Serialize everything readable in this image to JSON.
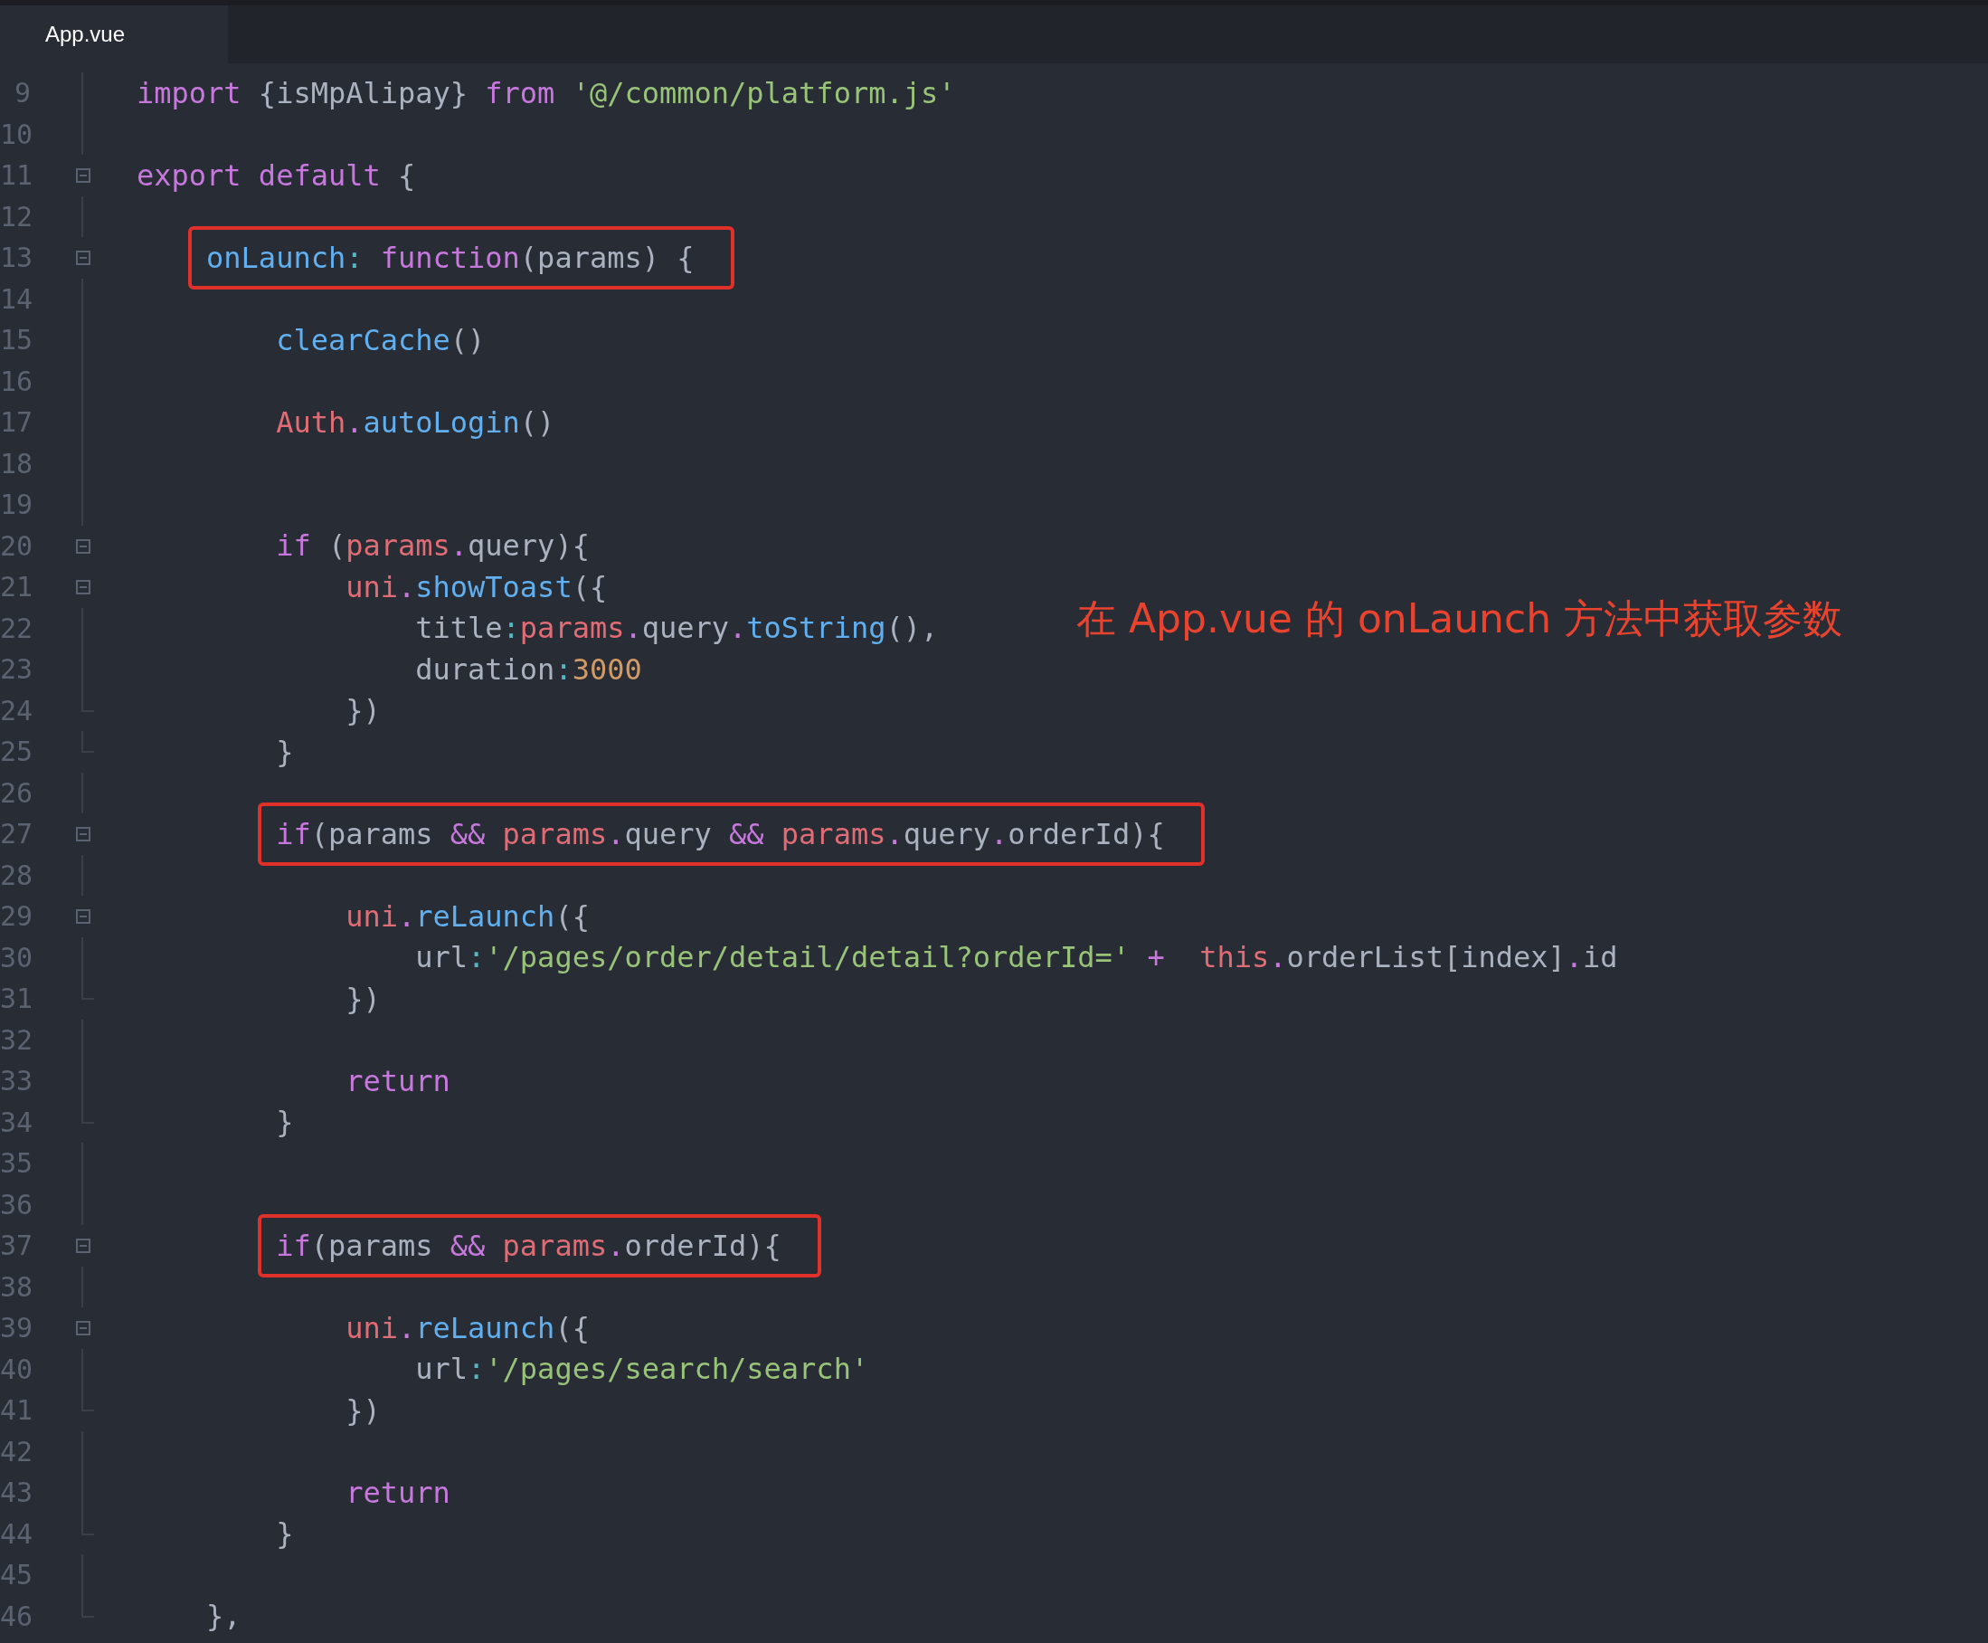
{
  "tab": {
    "label": "App.vue",
    "selected": true
  },
  "lines": [
    {
      "number": "9",
      "fold_start": false,
      "fold_end": false,
      "highlighted": false,
      "tokens": [
        {
          "text": "import",
          "kind": "kw"
        },
        {
          "text": " {isMpAlipay} ",
          "kind": "plain"
        },
        {
          "text": "from",
          "kind": "kw"
        },
        {
          "text": " '@/common/platform.js'",
          "kind": "str"
        }
      ]
    },
    {
      "number": "10",
      "fold_start": false,
      "fold_end": false,
      "highlighted": false
    },
    {
      "number": "11",
      "fold_start": true,
      "fold_end": false,
      "highlighted": false,
      "tokens": [
        {
          "text": "export default",
          "kind": "kw"
        },
        {
          "text": " {",
          "kind": "plain"
        }
      ]
    },
    {
      "number": "12",
      "fold_start": false,
      "fold_end": false,
      "highlighted": false
    },
    {
      "number": "13",
      "fold_start": true,
      "fold_end": false,
      "highlighted": true,
      "tokens": [
        {
          "text": "    onLaunch",
          "kind": "fn"
        },
        {
          "text": ":",
          "kind": "colon"
        },
        {
          "text": " function",
          "kind": "kw"
        },
        {
          "text": "(params) {",
          "kind": "plain"
        }
      ]
    },
    {
      "number": "14",
      "fold_start": false,
      "fold_end": false,
      "highlighted": false
    },
    {
      "number": "15",
      "fold_start": false,
      "fold_end": false,
      "highlighted": false,
      "tokens": [
        {
          "text": "        clearCache",
          "kind": "fn"
        },
        {
          "text": "()",
          "kind": "plain"
        }
      ]
    },
    {
      "number": "16",
      "fold_start": false,
      "fold_end": false,
      "highlighted": false
    },
    {
      "number": "17",
      "fold_start": false,
      "fold_end": false,
      "highlighted": false,
      "tokens": [
        {
          "text": "        Auth",
          "kind": "var"
        },
        {
          "text": ".",
          "kind": "op"
        },
        {
          "text": "autoLogin",
          "kind": "fn"
        },
        {
          "text": "()",
          "kind": "plain"
        }
      ]
    },
    {
      "number": "18",
      "fold_start": false,
      "fold_end": false,
      "highlighted": false
    },
    {
      "number": "19",
      "fold_start": false,
      "fold_end": false,
      "highlighted": false
    },
    {
      "number": "20",
      "fold_start": true,
      "fold_end": false,
      "highlighted": false,
      "tokens": [
        {
          "text": "        if",
          "kind": "kw"
        },
        {
          "text": " (",
          "kind": "plain"
        },
        {
          "text": "params",
          "kind": "var"
        },
        {
          "text": ".",
          "kind": "op"
        },
        {
          "text": "query){",
          "kind": "plain"
        }
      ]
    },
    {
      "number": "21",
      "fold_start": true,
      "fold_end": false,
      "highlighted": false,
      "tokens": [
        {
          "text": "            uni",
          "kind": "var"
        },
        {
          "text": ".",
          "kind": "op"
        },
        {
          "text": "showToast",
          "kind": "fn"
        },
        {
          "text": "({",
          "kind": "plain"
        }
      ]
    },
    {
      "number": "22",
      "fold_start": false,
      "fold_end": false,
      "highlighted": false,
      "tokens": [
        {
          "text": "                title",
          "kind": "plain"
        },
        {
          "text": ":",
          "kind": "colon"
        },
        {
          "text": "params",
          "kind": "var"
        },
        {
          "text": ".",
          "kind": "op"
        },
        {
          "text": "query",
          "kind": "plain"
        },
        {
          "text": ".",
          "kind": "op"
        },
        {
          "text": "toString",
          "kind": "fn"
        },
        {
          "text": "(),",
          "kind": "plain"
        }
      ]
    },
    {
      "number": "23",
      "fold_start": false,
      "fold_end": false,
      "highlighted": false,
      "tokens": [
        {
          "text": "                duration",
          "kind": "plain"
        },
        {
          "text": ":",
          "kind": "colon"
        },
        {
          "text": "3000",
          "kind": "num"
        }
      ]
    },
    {
      "number": "24",
      "fold_start": false,
      "fold_end": true,
      "highlighted": false,
      "tokens": [
        {
          "text": "            })",
          "kind": "plain"
        }
      ]
    },
    {
      "number": "25",
      "fold_start": false,
      "fold_end": true,
      "highlighted": false,
      "tokens": [
        {
          "text": "        }",
          "kind": "plain"
        }
      ]
    },
    {
      "number": "26",
      "fold_start": false,
      "fold_end": false,
      "highlighted": false
    },
    {
      "number": "27",
      "fold_start": true,
      "fold_end": false,
      "highlighted": true,
      "tokens": [
        {
          "text": "        if",
          "kind": "kw"
        },
        {
          "text": "(params ",
          "kind": "plain"
        },
        {
          "text": "&&",
          "kind": "op"
        },
        {
          "text": " params",
          "kind": "var"
        },
        {
          "text": ".",
          "kind": "op"
        },
        {
          "text": "query ",
          "kind": "plain"
        },
        {
          "text": "&&",
          "kind": "op"
        },
        {
          "text": " params",
          "kind": "var"
        },
        {
          "text": ".",
          "kind": "op"
        },
        {
          "text": "query",
          "kind": "plain"
        },
        {
          "text": ".",
          "kind": "op"
        },
        {
          "text": "orderId){",
          "kind": "plain"
        }
      ]
    },
    {
      "number": "28",
      "fold_start": false,
      "fold_end": false,
      "highlighted": false
    },
    {
      "number": "29",
      "fold_start": true,
      "fold_end": false,
      "highlighted": false,
      "tokens": [
        {
          "text": "            uni",
          "kind": "var"
        },
        {
          "text": ".",
          "kind": "op"
        },
        {
          "text": "reLaunch",
          "kind": "fn"
        },
        {
          "text": "({",
          "kind": "plain"
        }
      ]
    },
    {
      "number": "30",
      "fold_start": false,
      "fold_end": false,
      "highlighted": false,
      "tokens": [
        {
          "text": "                url",
          "kind": "plain"
        },
        {
          "text": ":",
          "kind": "colon"
        },
        {
          "text": "'/pages/order/detail/detail?orderId='",
          "kind": "str"
        },
        {
          "text": " +",
          "kind": "op"
        },
        {
          "text": "  this",
          "kind": "var"
        },
        {
          "text": ".",
          "kind": "op"
        },
        {
          "text": "orderList[index]",
          "kind": "plain"
        },
        {
          "text": ".",
          "kind": "op"
        },
        {
          "text": "id",
          "kind": "plain"
        }
      ]
    },
    {
      "number": "31",
      "fold_start": false,
      "fold_end": true,
      "highlighted": false,
      "tokens": [
        {
          "text": "            })",
          "kind": "plain"
        }
      ]
    },
    {
      "number": "32",
      "fold_start": false,
      "fold_end": false,
      "highlighted": false
    },
    {
      "number": "33",
      "fold_start": false,
      "fold_end": false,
      "highlighted": false,
      "tokens": [
        {
          "text": "            return",
          "kind": "kw"
        }
      ]
    },
    {
      "number": "34",
      "fold_start": false,
      "fold_end": true,
      "highlighted": false,
      "tokens": [
        {
          "text": "        }",
          "kind": "plain"
        }
      ]
    },
    {
      "number": "35",
      "fold_start": false,
      "fold_end": false,
      "highlighted": false
    },
    {
      "number": "36",
      "fold_start": false,
      "fold_end": false,
      "highlighted": false
    },
    {
      "number": "37",
      "fold_start": true,
      "fold_end": false,
      "highlighted": true,
      "tokens": [
        {
          "text": "        if",
          "kind": "kw"
        },
        {
          "text": "(params ",
          "kind": "plain"
        },
        {
          "text": "&&",
          "kind": "op"
        },
        {
          "text": " params",
          "kind": "var"
        },
        {
          "text": ".",
          "kind": "op"
        },
        {
          "text": "orderId){",
          "kind": "plain"
        }
      ]
    },
    {
      "number": "38",
      "fold_start": false,
      "fold_end": false,
      "highlighted": false
    },
    {
      "number": "39",
      "fold_start": true,
      "fold_end": false,
      "highlighted": false,
      "tokens": [
        {
          "text": "            uni",
          "kind": "var"
        },
        {
          "text": ".",
          "kind": "op"
        },
        {
          "text": "reLaunch",
          "kind": "fn"
        },
        {
          "text": "({",
          "kind": "plain"
        }
      ]
    },
    {
      "number": "40",
      "fold_start": false,
      "fold_end": false,
      "highlighted": false,
      "tokens": [
        {
          "text": "                url",
          "kind": "plain"
        },
        {
          "text": ":",
          "kind": "colon"
        },
        {
          "text": "'/pages/search/search'",
          "kind": "str"
        }
      ]
    },
    {
      "number": "41",
      "fold_start": false,
      "fold_end": true,
      "highlighted": false,
      "tokens": [
        {
          "text": "            })",
          "kind": "plain"
        }
      ]
    },
    {
      "number": "42",
      "fold_start": false,
      "fold_end": false,
      "highlighted": false
    },
    {
      "number": "43",
      "fold_start": false,
      "fold_end": false,
      "highlighted": false,
      "tokens": [
        {
          "text": "            return",
          "kind": "kw"
        }
      ]
    },
    {
      "number": "44",
      "fold_start": false,
      "fold_end": true,
      "highlighted": false,
      "tokens": [
        {
          "text": "        }",
          "kind": "plain"
        }
      ]
    },
    {
      "number": "45",
      "fold_start": false,
      "fold_end": false,
      "highlighted": false
    },
    {
      "number": "46",
      "fold_start": false,
      "fold_end": true,
      "highlighted": false,
      "tokens": [
        {
          "text": "    },",
          "kind": "plain"
        }
      ]
    }
  ],
  "annotation": {
    "text": "在 App.vue 的 onLaunch 方法中获取参数"
  }
}
